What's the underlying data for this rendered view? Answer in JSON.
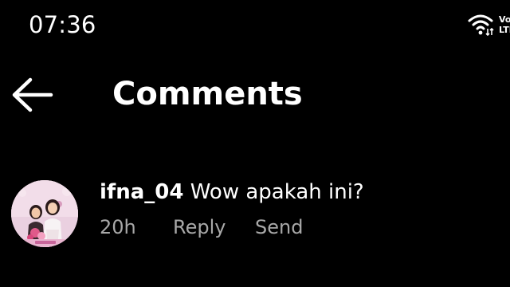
{
  "status_bar": {
    "time": "07:36",
    "network_top": "Vo",
    "network_bottom": "LTE"
  },
  "header": {
    "title": "Comments",
    "back_icon": "arrow-left-icon"
  },
  "comments": [
    {
      "username": "ifna_04",
      "text": "Wow apakah ini?",
      "time": "20h",
      "reply_label": "Reply",
      "send_label": "Send"
    }
  ],
  "colors": {
    "background": "#000000",
    "primary_text": "#ffffff",
    "secondary_text": "#a8a8a8",
    "avatar_bg": "#e9bfd6"
  }
}
